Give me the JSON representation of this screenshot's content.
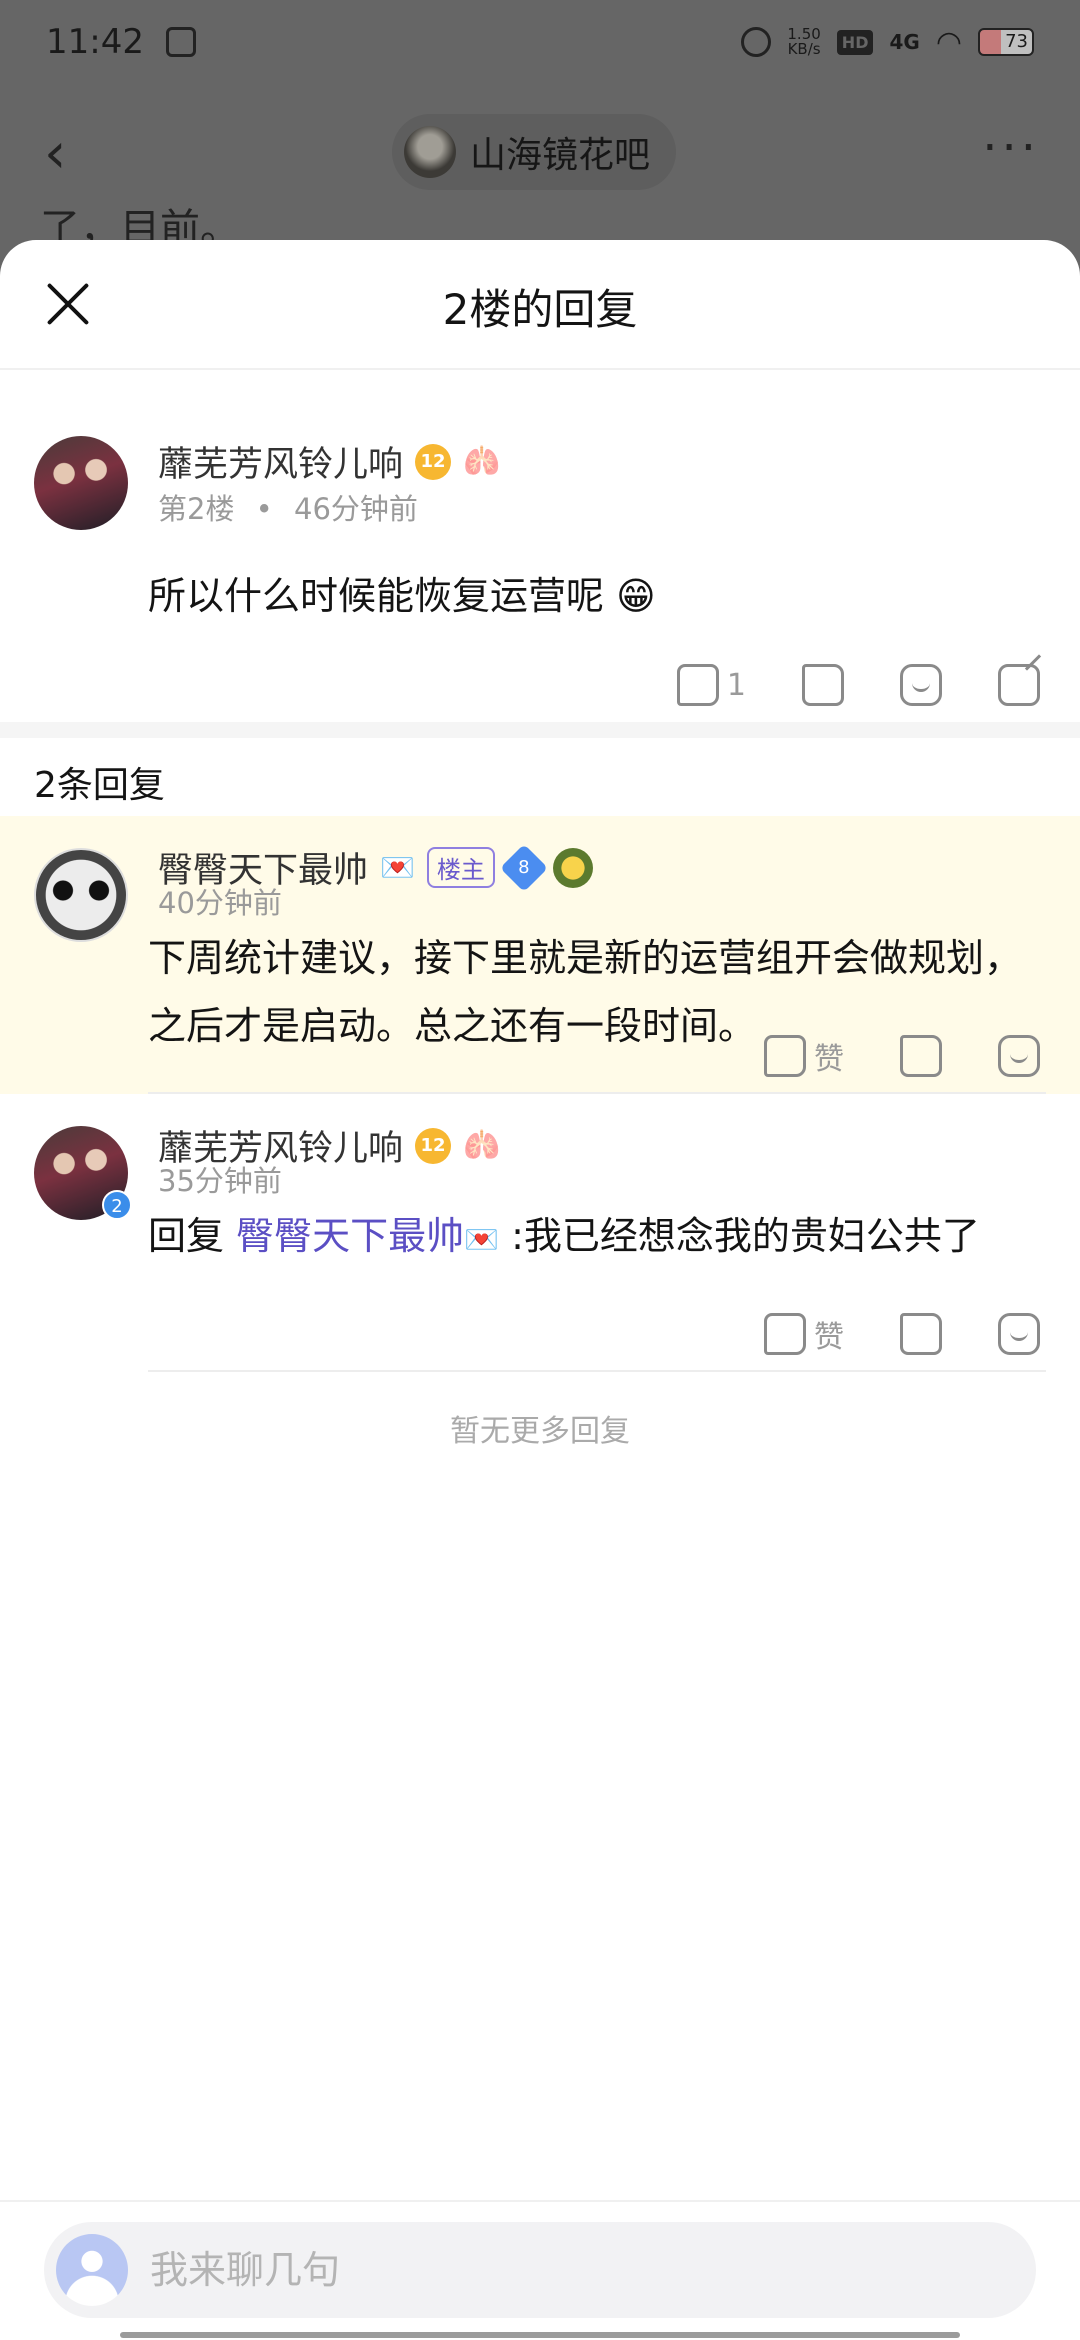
{
  "status_bar": {
    "time": "11:42",
    "net_speed": "1.50",
    "net_unit": "KB/s",
    "hd": "HD",
    "signal": "4G",
    "battery": "73"
  },
  "page": {
    "forum_name": "山海镜花吧",
    "peek_text": "了，目前。"
  },
  "sheet": {
    "title": "2楼的回复"
  },
  "floor_post": {
    "username": "蘼芜芳风铃儿响",
    "level": "12",
    "floor": "第2楼",
    "dot": "•",
    "time": "46分钟前",
    "content": "所以什么时候能恢复运营呢 😁",
    "like_count": "1"
  },
  "replies_header": "2条回复",
  "replies": [
    {
      "username": "臀臀天下最帅",
      "owner_tag": "楼主",
      "level": "8",
      "time": "40分钟前",
      "content": "下周统计建议，接下里就是新的运营组开会做规划，之后才是启动。总之还有一段时间。",
      "like_label": "赞"
    },
    {
      "username": "蘼芜芳风铃儿响",
      "level": "12",
      "avatar_badge": "2",
      "time": "35分钟前",
      "reply_prefix": "回复",
      "mention": "臀臀天下最帅",
      "content": " :我已经想念我的贵妇公共了",
      "like_label": "赞"
    }
  ],
  "no_more": "暂无更多回复",
  "input": {
    "placeholder": "我来聊几句"
  },
  "colors": {
    "highlight_bg": "#fffbe8",
    "mention": "#5b4fc4",
    "owner_tag": "#6a5acd"
  }
}
